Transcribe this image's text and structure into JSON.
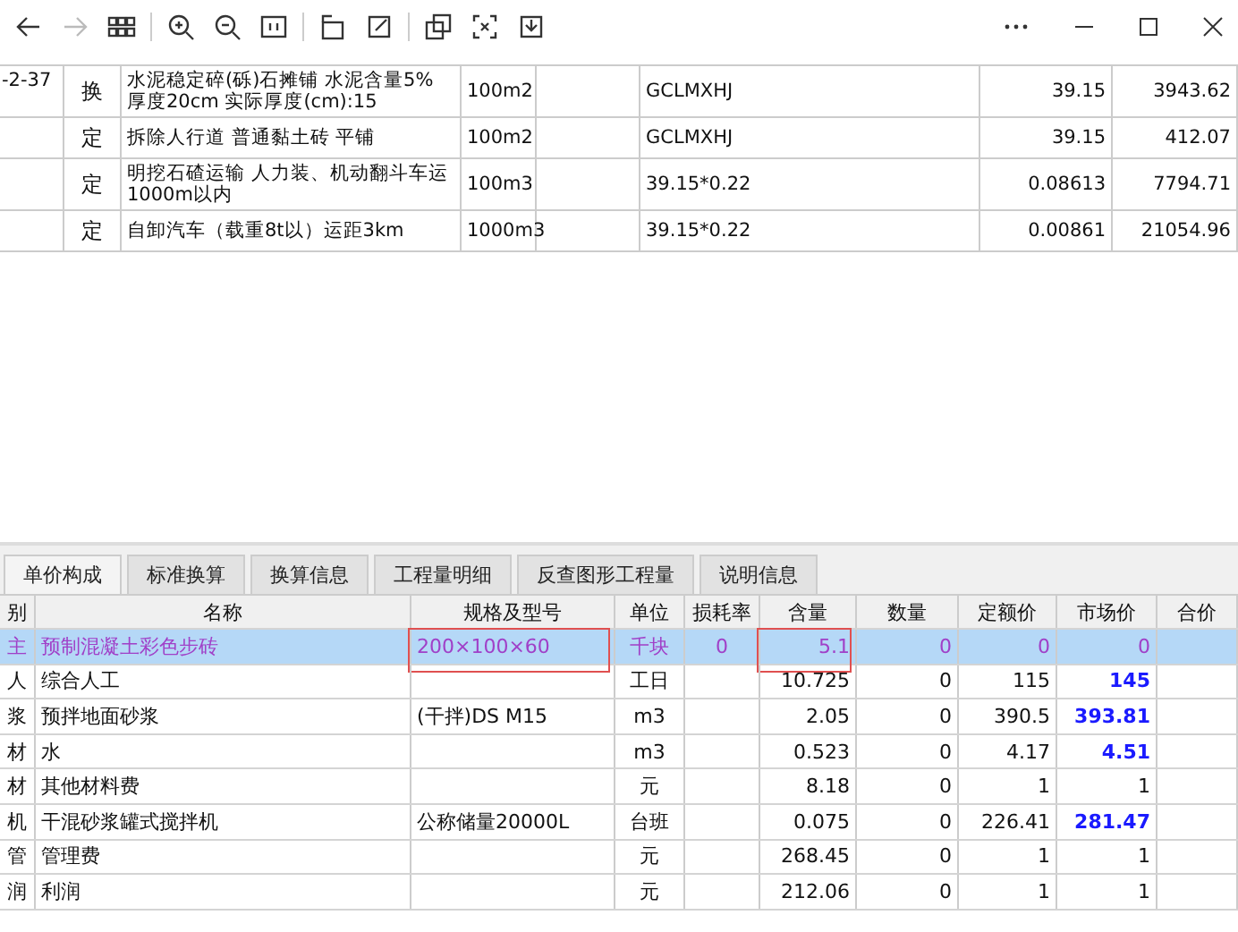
{
  "toolbar": {
    "tools": [
      {
        "kind": "back",
        "disabled": false
      },
      {
        "kind": "forward",
        "disabled": true
      },
      {
        "kind": "grid",
        "disabled": false
      },
      {
        "kind": "sep"
      },
      {
        "kind": "zoom-in",
        "disabled": false
      },
      {
        "kind": "zoom-out",
        "disabled": false
      },
      {
        "kind": "fit",
        "disabled": false
      },
      {
        "kind": "sep"
      },
      {
        "kind": "rotate",
        "disabled": false
      },
      {
        "kind": "edit",
        "disabled": false
      },
      {
        "kind": "sep"
      },
      {
        "kind": "copy",
        "disabled": false
      },
      {
        "kind": "crop",
        "disabled": false
      },
      {
        "kind": "save",
        "disabled": false
      }
    ]
  },
  "upper_table": {
    "rows": [
      {
        "code": "-2-37",
        "type": "换",
        "name": "水泥稳定碎(砾)石摊铺 水泥含量5% 厚度20cm  实际厚度(cm):15",
        "unit": "100m2",
        "expression": "GCLMXHJ",
        "quantity": "39.15",
        "column_8": "3943.62"
      },
      {
        "code": "",
        "type": "定",
        "name": "拆除人行道 普通黏土砖 平铺",
        "unit": "100m2",
        "expression": "GCLMXHJ",
        "quantity": "39.15",
        "column_8": "412.07"
      },
      {
        "code": "",
        "type": "定",
        "name": "明挖石碴运输 人力装、机动翻斗车运1000m以内",
        "unit": "100m3",
        "expression": "39.15*0.22",
        "quantity": "0.08613",
        "column_8": "7794.71"
      },
      {
        "code": "",
        "type": "定",
        "name": "自卸汽车（载重8t以）运距3km",
        "unit": "1000m3",
        "expression": "39.15*0.22",
        "quantity": "0.00861",
        "column_8": "21054.96"
      }
    ]
  },
  "tabs": [
    {
      "label": "单价构成",
      "selected": true
    },
    {
      "label": "标准换算",
      "selected": false
    },
    {
      "label": "换算信息",
      "selected": false
    },
    {
      "label": "工程量明细",
      "selected": false
    },
    {
      "label": "反查图形工程量",
      "selected": false
    },
    {
      "label": "说明信息",
      "selected": false
    }
  ],
  "grid": {
    "columns": [
      "别",
      "名称",
      "规格及型号",
      "单位",
      "损耗率",
      "含量",
      "数量",
      "定额价",
      "市场价",
      "合价"
    ],
    "rows": [
      {
        "type": "主",
        "name": "预制混凝土彩色步砖",
        "spec": "200×100×60",
        "unit": "千块",
        "loss": "0",
        "content": "5.1",
        "qty": "0",
        "quota_price": "0",
        "market_price": "0",
        "adjusted": false,
        "selected": true,
        "spec_boxed": true,
        "content_boxed": true
      },
      {
        "type": "人",
        "name": "综合人工",
        "spec": "",
        "unit": "工日",
        "loss": "",
        "content": "10.725",
        "qty": "0",
        "quota_price": "115",
        "market_price": "145",
        "adjusted": true,
        "selected": false,
        "spec_boxed": false,
        "content_boxed": false
      },
      {
        "type": "浆",
        "name": "预拌地面砂浆",
        "spec": "(干拌)DS M15",
        "unit": "m3",
        "loss": "",
        "content": "2.05",
        "qty": "0",
        "quota_price": "390.5",
        "market_price": "393.81",
        "adjusted": true,
        "selected": false,
        "spec_boxed": false,
        "content_boxed": false
      },
      {
        "type": "材",
        "name": "水",
        "spec": "",
        "unit": "m3",
        "loss": "",
        "content": "0.523",
        "qty": "0",
        "quota_price": "4.17",
        "market_price": "4.51",
        "adjusted": true,
        "selected": false,
        "spec_boxed": false,
        "content_boxed": false
      },
      {
        "type": "材",
        "name": "其他材料费",
        "spec": "",
        "unit": "元",
        "loss": "",
        "content": "8.18",
        "qty": "0",
        "quota_price": "1",
        "market_price": "1",
        "adjusted": false,
        "selected": false,
        "spec_boxed": false,
        "content_boxed": false
      },
      {
        "type": "机",
        "name": "干混砂浆罐式搅拌机",
        "spec": "公称储量20000L",
        "unit": "台班",
        "loss": "",
        "content": "0.075",
        "qty": "0",
        "quota_price": "226.41",
        "market_price": "281.47",
        "adjusted": true,
        "selected": false,
        "spec_boxed": false,
        "content_boxed": false
      },
      {
        "type": "管",
        "name": "管理费",
        "spec": "",
        "unit": "元",
        "loss": "",
        "content": "268.45",
        "qty": "0",
        "quota_price": "1",
        "market_price": "1",
        "adjusted": false,
        "selected": false,
        "spec_boxed": false,
        "content_boxed": false
      },
      {
        "type": "润",
        "name": "利润",
        "spec": "",
        "unit": "元",
        "loss": "",
        "content": "212.06",
        "qty": "0",
        "quota_price": "1",
        "market_price": "1",
        "adjusted": false,
        "selected": false,
        "spec_boxed": false,
        "content_boxed": false
      }
    ]
  }
}
